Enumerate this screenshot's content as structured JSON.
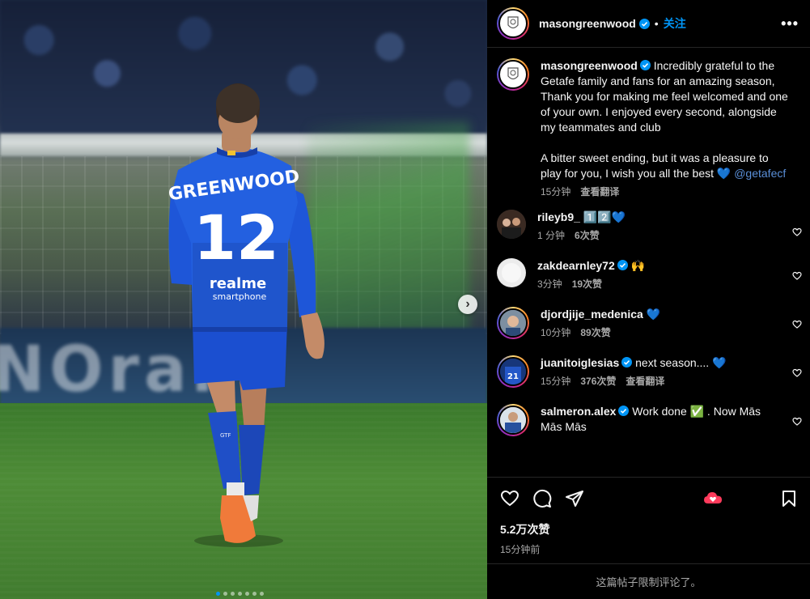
{
  "post": {
    "author": "masongreenwood",
    "follow_label": "关注",
    "more_label": "•••",
    "carousel_total": 7,
    "carousel_index": 0
  },
  "caption": {
    "username": "masongreenwood",
    "para1": "Incredibly grateful to the Getafe family and fans for an amazing season, Thank you for making me feel welcomed and one of your own. I enjoyed every second, alongside my teammates and club",
    "para2_text": "A bitter sweet ending, but it was a pleasure to play for you, I wish you all the best",
    "para2_emoji": "💙",
    "mention": "@getafecf",
    "time": "15分钟",
    "translate": "查看翻译"
  },
  "comments": [
    {
      "username": "rileyb9_",
      "verified": false,
      "text": "1️⃣2️⃣💙",
      "time": "1 分钟",
      "likes": "6次赞",
      "reply": ""
    },
    {
      "username": "zakdearnley72",
      "verified": true,
      "text": "🙌",
      "time": "3分钟",
      "likes": "19次赞",
      "reply": ""
    },
    {
      "username": "djordjije_medenica",
      "verified": false,
      "text": "💙",
      "time": "10分钟",
      "likes": "89次赞",
      "reply": ""
    },
    {
      "username": "juanitoiglesias",
      "verified": true,
      "text": "next season.... 💙",
      "time": "15分钟",
      "likes": "376次赞",
      "reply": "查看翻译"
    },
    {
      "username": "salmeron.alex",
      "verified": true,
      "text": "Work done ✅ . Now Mās Mās Mās",
      "time": "",
      "likes": "",
      "reply": ""
    }
  ],
  "stats": {
    "likes": "5.2万次赞",
    "time": "15分钟前"
  },
  "footer": {
    "notice": "这篇帖子限制评论了。"
  },
  "icons": {
    "like": "heart-icon",
    "comment": "comment-icon",
    "share": "send-icon",
    "special": "heart-cloud-icon",
    "save": "bookmark-icon",
    "next": "chevron-right-icon"
  },
  "colors": {
    "accent": "#0095f6",
    "background": "#000000",
    "muted": "#a8a8a8",
    "mention": "#5a8fd8",
    "special_icon": "#ff3b5c"
  },
  "photo": {
    "jersey_name": "GREENWOOD",
    "jersey_number": "12",
    "sponsor_top": "realme",
    "sponsor_bottom": "smartphone",
    "board_text": "NOral"
  }
}
